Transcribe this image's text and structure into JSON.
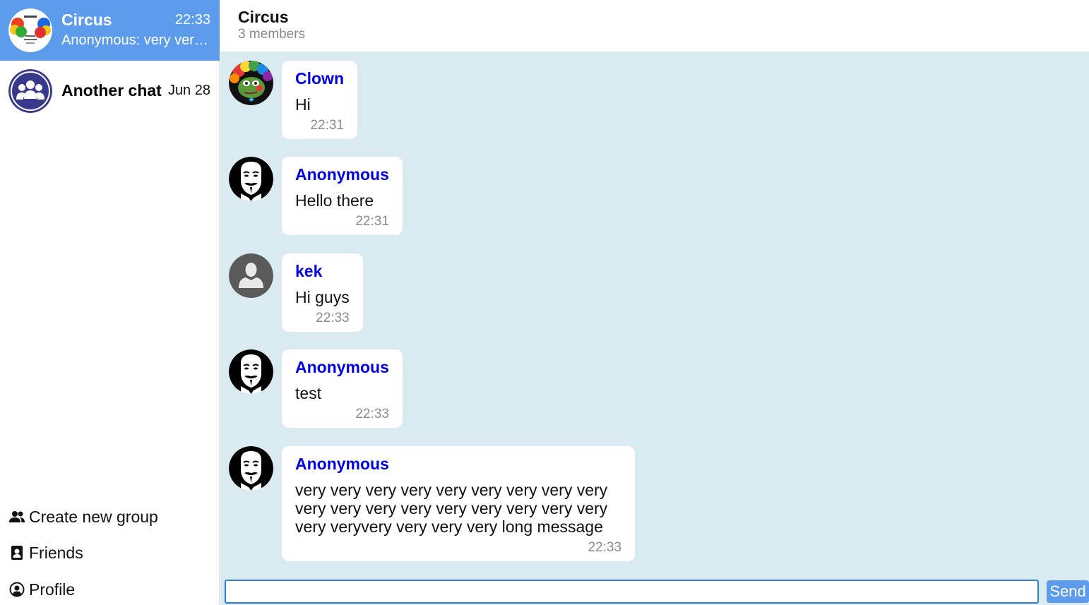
{
  "sidebar": {
    "chats": [
      {
        "name": "Circus",
        "time": "22:33",
        "preview": "Anonymous: very very very very very very very very very",
        "active": true
      },
      {
        "name": "Another chat",
        "time": "Jun 28",
        "preview": "",
        "active": false
      }
    ],
    "links": [
      {
        "label": "Create new group",
        "icon": "group-icon"
      },
      {
        "label": "Friends",
        "icon": "contact-card-icon"
      },
      {
        "label": "Profile",
        "icon": "user-circle-icon"
      }
    ]
  },
  "header": {
    "title": "Circus",
    "members": "3 members"
  },
  "messages": [
    {
      "author": "Clown",
      "text": "Hi",
      "time": "22:31",
      "avatar": "clown-avatar"
    },
    {
      "author": "Anonymous",
      "text": "Hello there",
      "time": "22:31",
      "avatar": "guy-fawkes-avatar"
    },
    {
      "author": "kek",
      "text": "Hi guys",
      "time": "22:33",
      "avatar": "default-user-avatar"
    },
    {
      "author": "Anonymous",
      "text": "test",
      "time": "22:33",
      "avatar": "guy-fawkes-avatar"
    },
    {
      "author": "Anonymous",
      "text": "very very very very very very very very very very very very very very very very very very very veryvery very very very long message",
      "time": "22:33",
      "avatar": "guy-fawkes-avatar"
    }
  ],
  "composer": {
    "value": "",
    "placeholder": "",
    "send_label": "Send"
  },
  "colors": {
    "accent": "#5d9cec",
    "chat_background": "#daeaf1",
    "author_name": "#0000e6"
  }
}
